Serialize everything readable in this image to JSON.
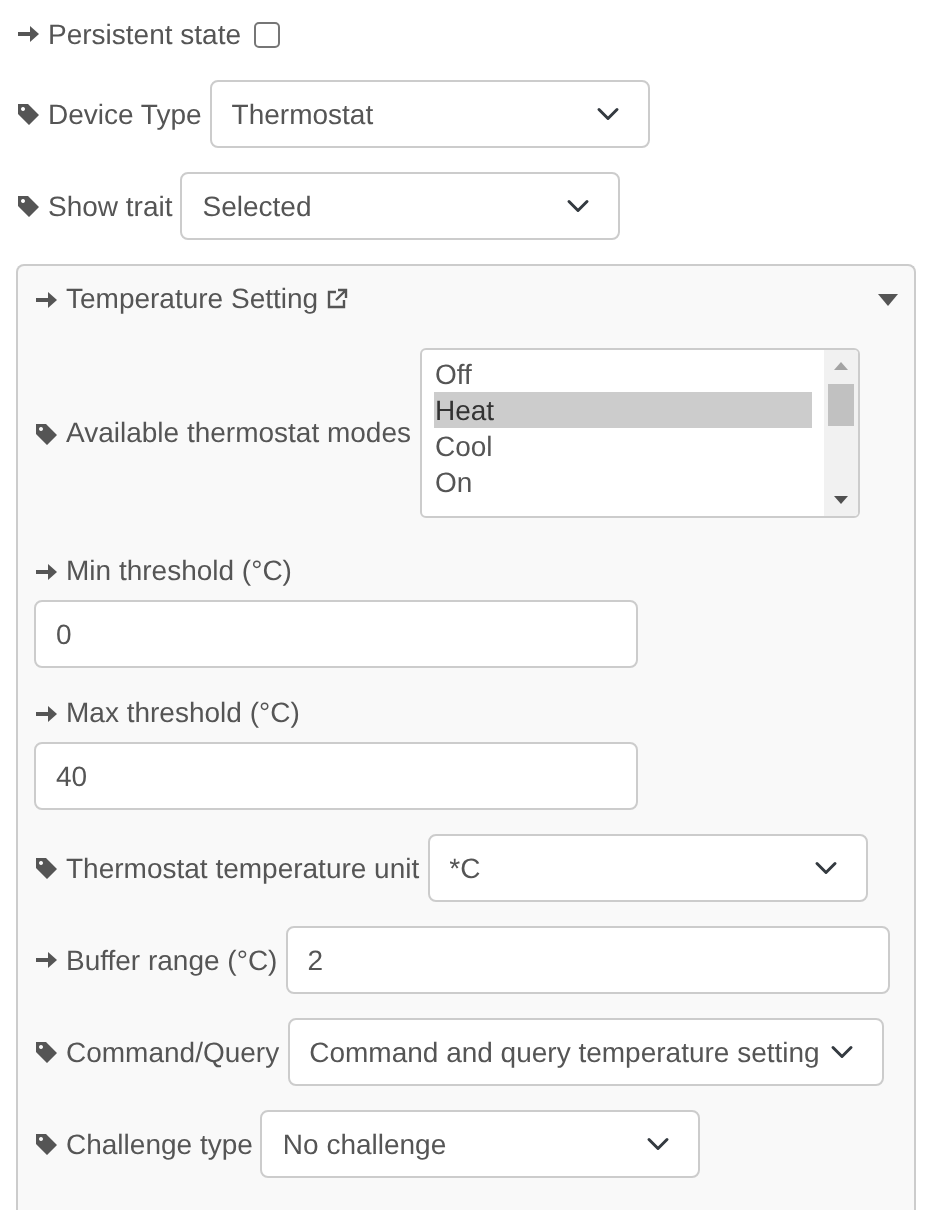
{
  "fields": [
    {
      "label": "Persistent state",
      "kind": "checkbox",
      "checked": false
    },
    {
      "label": "Device Type",
      "kind": "select",
      "value": "Thermostat"
    },
    {
      "label": "Show trait",
      "kind": "select",
      "value": "Selected"
    }
  ],
  "panel": {
    "title": "Temperature Setting",
    "expanded": true,
    "fields": [
      {
        "label": "Available thermostat modes",
        "kind": "listbox",
        "options": [
          {
            "label": "Off",
            "selected": false
          },
          {
            "label": "Heat",
            "selected": true
          },
          {
            "label": "Cool",
            "selected": false
          },
          {
            "label": "On",
            "selected": false
          }
        ]
      },
      {
        "label": "Min threshold (°C)",
        "kind": "input-stacked",
        "value": "0"
      },
      {
        "label": "Max threshold (°C)",
        "kind": "input-stacked",
        "value": "40"
      },
      {
        "label": "Thermostat temperature unit",
        "kind": "select",
        "value": "*C"
      },
      {
        "label": "Buffer range (°C)",
        "kind": "input",
        "value": "2"
      },
      {
        "label": "Command/Query",
        "kind": "select",
        "value": "Command and query temperature setting"
      },
      {
        "label": "Challenge type",
        "kind": "select",
        "value": "No challenge"
      }
    ]
  }
}
